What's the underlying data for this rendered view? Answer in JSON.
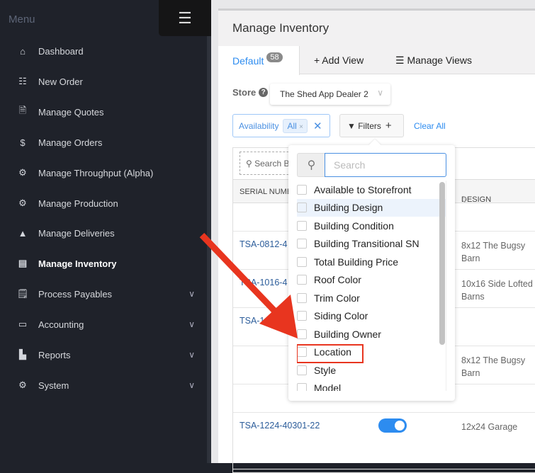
{
  "sidebar": {
    "title": "Menu",
    "items": [
      {
        "label": "Dashboard",
        "icon": "home-icon"
      },
      {
        "label": "New Order",
        "icon": "list-icon"
      },
      {
        "label": "Manage Quotes",
        "icon": "file-icon"
      },
      {
        "label": "Manage Orders",
        "icon": "invoice-icon"
      },
      {
        "label": "Manage Throughput (Alpha)",
        "icon": "gear-icon"
      },
      {
        "label": "Manage Production",
        "icon": "gear-icon"
      },
      {
        "label": "Manage Deliveries",
        "icon": "road-icon"
      },
      {
        "label": "Manage Inventory",
        "icon": "warehouse-icon",
        "active": true
      },
      {
        "label": "Process Payables",
        "icon": "receipt-icon"
      },
      {
        "label": "Accounting",
        "icon": "credit-card-icon"
      },
      {
        "label": "Reports",
        "icon": "chart-icon"
      },
      {
        "label": "System",
        "icon": "gears-icon"
      }
    ]
  },
  "header": {
    "title": "Manage Inventory"
  },
  "tabs": {
    "default": "Default",
    "count": "58",
    "add_view": "+ Add View",
    "manage_views": "Manage Views"
  },
  "store": {
    "label": "Store",
    "value": "The Shed App Dealer 2"
  },
  "filters": {
    "availability_label": "Availability",
    "availability_value": "All",
    "filters_label": "Filters",
    "clear_all": "Clear All"
  },
  "table": {
    "search_placeholder": "Search B",
    "col_serial": "SERIAL NUMB",
    "col_design": "DESIGN",
    "rows": [
      {
        "serial": "",
        "design": ""
      },
      {
        "serial": "TSA-0812-4",
        "design": "8x12 The Bugsy Barn"
      },
      {
        "serial": "TSA-1016-4",
        "design": "10x16 Side Lofted Barns"
      },
      {
        "serial": "TSA-1",
        "design": ""
      },
      {
        "serial": "",
        "design": "8x12 The Bugsy Barn"
      },
      {
        "serial": "",
        "design": ""
      },
      {
        "serial": "TSA-1224-40301-22",
        "design": "12x24 Garage",
        "toggle": true
      }
    ]
  },
  "dropdown": {
    "search_placeholder": "Search",
    "options": [
      "Available to Storefront",
      "Building Design",
      "Building Condition",
      "Building Transitional SN",
      "Total Building Price",
      "Roof Color",
      "Trim Color",
      "Siding Color",
      "Building Owner",
      "Location",
      "Style",
      "Model"
    ],
    "highlighted": "Location",
    "hovered": "Building Design"
  },
  "colors": {
    "accent": "#2d8cf0",
    "annotation": "#e8351f",
    "sidebar": "#1f222a"
  }
}
